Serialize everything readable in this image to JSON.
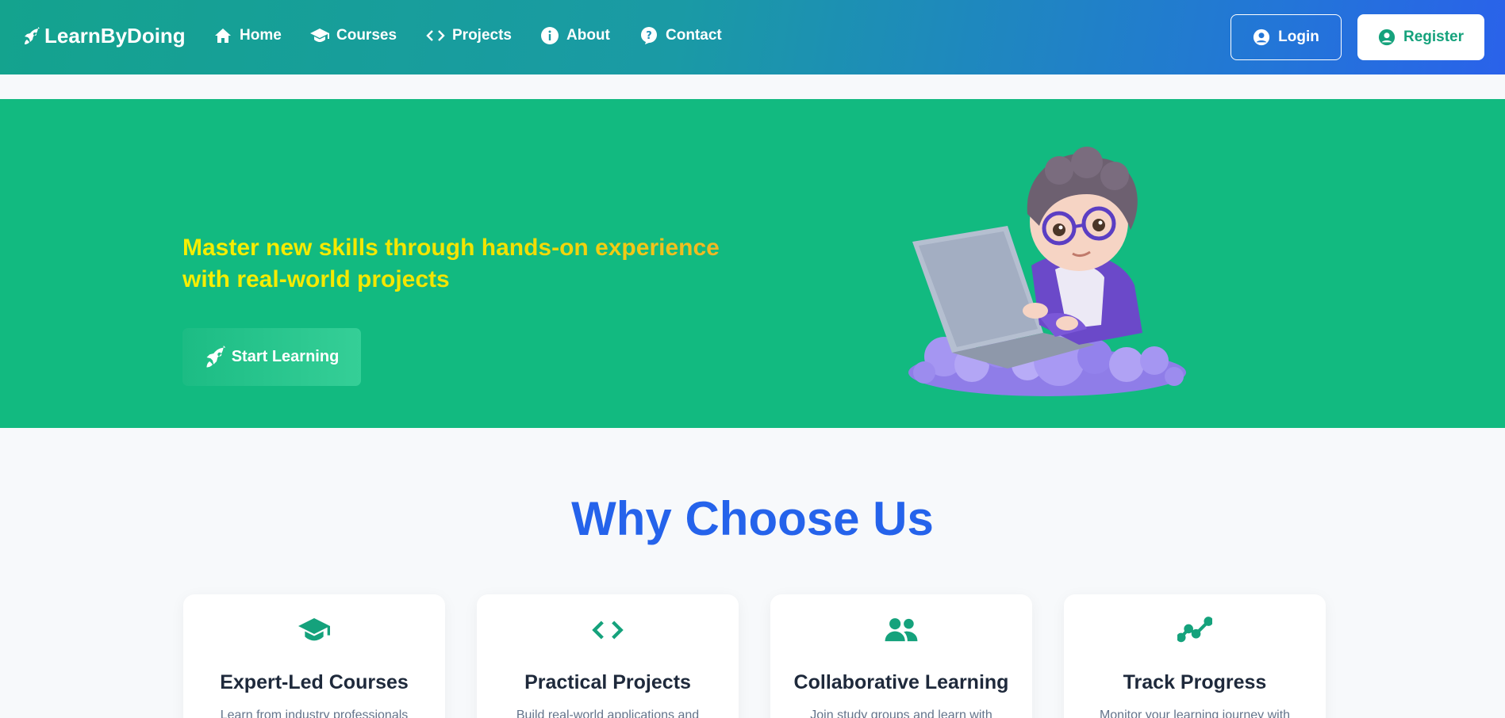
{
  "header": {
    "brand": "LearnByDoing",
    "nav": [
      {
        "label": "Home",
        "icon": "home-icon"
      },
      {
        "label": "Courses",
        "icon": "graduation-cap-icon"
      },
      {
        "label": "Projects",
        "icon": "code-icon"
      },
      {
        "label": "About",
        "icon": "info-icon"
      },
      {
        "label": "Contact",
        "icon": "question-bubble-icon"
      }
    ],
    "login_label": "Login",
    "register_label": "Register"
  },
  "hero": {
    "headline_line1": "Master new skills through hands-on experience",
    "headline_line2": "with real-world projects",
    "cta_label": "Start Learning"
  },
  "why": {
    "title": "Why Choose Us",
    "cards": [
      {
        "title": "Expert-Led Courses",
        "text": "Learn from industry professionals",
        "icon": "graduation-cap-icon"
      },
      {
        "title": "Practical Projects",
        "text": "Build real-world applications and",
        "icon": "code-icon"
      },
      {
        "title": "Collaborative Learning",
        "text": "Join study groups and learn with",
        "icon": "users-icon"
      },
      {
        "title": "Track Progress",
        "text": "Monitor your learning journey with",
        "icon": "trend-line-icon"
      }
    ]
  },
  "colors": {
    "hero_bg": "#12ba80",
    "accent_green": "#15a27c",
    "title_blue": "#2563eb",
    "headline_yellow": "#f2e300"
  }
}
